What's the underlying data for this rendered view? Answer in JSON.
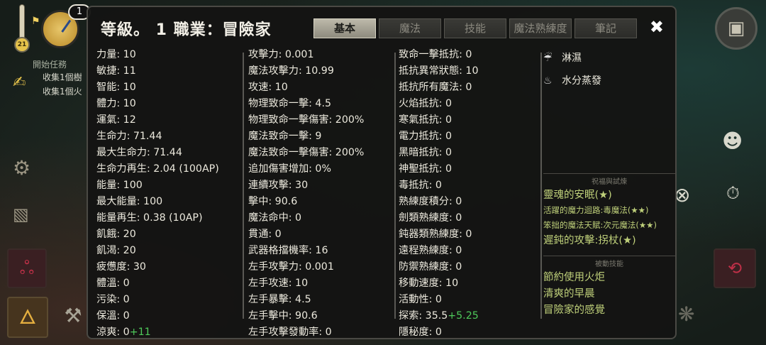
{
  "background_hud": {
    "thermometer_value": "21",
    "clock_badge": "1",
    "quest_title": "開始任務",
    "quest_lines": [
      "收集1個樹",
      "收集1個火"
    ]
  },
  "panel": {
    "title": "等級。 1 職業：冒險家",
    "tabs": [
      "基本",
      "魔法",
      "技能",
      "魔法熟練度",
      "筆記"
    ],
    "active_tab": "基本",
    "close_label": "✖"
  },
  "col1": [
    "力量: 10",
    "敏捷: 11",
    "智能: 10",
    "體力: 10",
    "運氣: 12",
    "生命力: 71.44",
    "最大生命力: 71.44",
    "生命力再生: 2.04 (100AP)",
    "能量: 100",
    "最大能量: 100",
    "能量再生: 0.38 (10AP)",
    "飢餓: 20",
    "飢渴: 20",
    "疲憊度: 30",
    "體溫: 0",
    "污染: 0",
    "保溫: 0"
  ],
  "col1_last": {
    "text": "涼爽: 0",
    "bonus": "+11"
  },
  "col2": [
    "攻擊力: 0.001",
    "魔法攻擊力: 10.99",
    "攻速: 10",
    "物理致命一擊: 4.5",
    "物理致命一擊傷害: 200%",
    "魔法致命一擊: 9",
    "魔法致命一擊傷害: 200%",
    "追加傷害增加: 0%",
    "連續攻擊: 30",
    "擊中: 90.6",
    "魔法命中: 0",
    "貫通: 0",
    "武器格擋機率: 16",
    "左手攻擊力: 0.001",
    "左手攻速: 10",
    "左手暴擊: 4.5",
    "左手擊中: 90.6",
    "左手攻擊發動率: 0"
  ],
  "col3": [
    "致命一擊抵抗: 0",
    "抵抗異常狀態: 10",
    "抵抗所有魔法: 0",
    "火焰抵抗: 0",
    "寒氣抵抗: 0",
    "電力抵抗: 0",
    "黑暗抵抗: 0",
    "神聖抵抗: 0",
    "毒抵抗: 0",
    "熟練度積分: 0",
    "劍類熟練度: 0",
    "鈍器類熟練度: 0",
    "遠程熟練度: 0",
    "防禦熟練度: 0",
    "移動速度: 10",
    "活動性: 0"
  ],
  "col3_explore": {
    "text": "探索: 35.5",
    "bonus": "+5.25"
  },
  "col3_last": "隱秘度: 0",
  "effects": [
    {
      "icon": "rain-icon",
      "glyph": "☔",
      "label": "淋濕"
    },
    {
      "icon": "steam-icon",
      "glyph": "♨",
      "label": "水分蒸發"
    }
  ],
  "blessing_header": "祝福與試煉",
  "blessings": [
    {
      "label": "靈魂的安眠(★)",
      "size": "large"
    },
    {
      "label": "活躍的魔力迴路:毒魔法(★★)",
      "size": "small"
    },
    {
      "label": "笨拙的魔法天賦:次元魔法(★★)",
      "size": "small"
    },
    {
      "label": "遲鈍的攻擊:拐杖(★)",
      "size": "large"
    }
  ],
  "passive_header": "被動技能",
  "passives": [
    "節約使用火炬",
    "清爽的早晨",
    "冒險家的感覺"
  ],
  "colors": {
    "bonus": "#4ec95a",
    "buff": "#bfd07a",
    "active_tab": "#bdb9aa"
  }
}
